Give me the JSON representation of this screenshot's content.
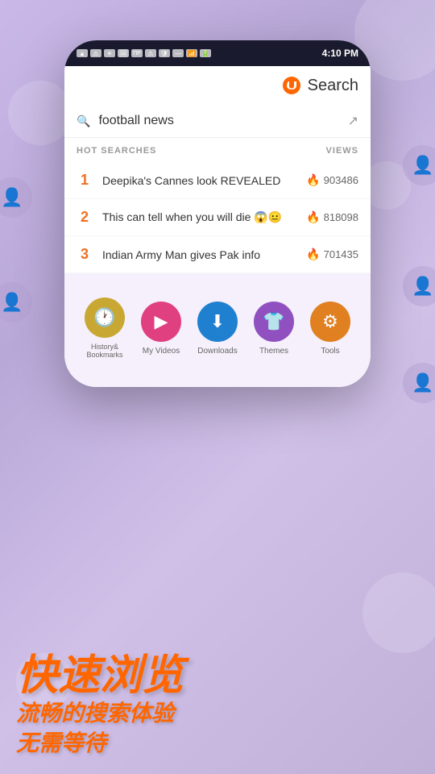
{
  "page": {
    "background": {
      "colors": [
        "#c9b8e8",
        "#b8a8d8"
      ]
    }
  },
  "statusBar": {
    "time": "4:10 PM"
  },
  "header": {
    "searchLabel": "Search"
  },
  "searchInput": {
    "value": "football news",
    "arrowIcon": "↗"
  },
  "hotSearches": {
    "headerLabel": "HOT SEARCHES",
    "viewsLabel": "VIEWS",
    "items": [
      {
        "rank": "1",
        "title": "Deepika's Cannes look REVEALED",
        "views": "903486"
      },
      {
        "rank": "2",
        "title": "This can tell when you will die 😱😐",
        "views": "818098"
      },
      {
        "rank": "3",
        "title": "Indian Army Man gives Pak info",
        "views": "701435"
      }
    ]
  },
  "quickAccess": {
    "items": [
      {
        "label": "History&\nBookmarks",
        "icon": "🕐",
        "color": "#c8a832"
      },
      {
        "label": "My Videos",
        "icon": "▶",
        "color": "#e04080"
      },
      {
        "label": "Downloads",
        "icon": "⬇",
        "color": "#2080d0"
      },
      {
        "label": "Themes",
        "icon": "👕",
        "color": "#9050c0"
      },
      {
        "label": "Tools",
        "icon": "⚙",
        "color": "#e08020"
      }
    ]
  },
  "chineseText": {
    "line1": "快速浏览",
    "line2": "流畅的搜索体验",
    "line3": "无需等待"
  }
}
